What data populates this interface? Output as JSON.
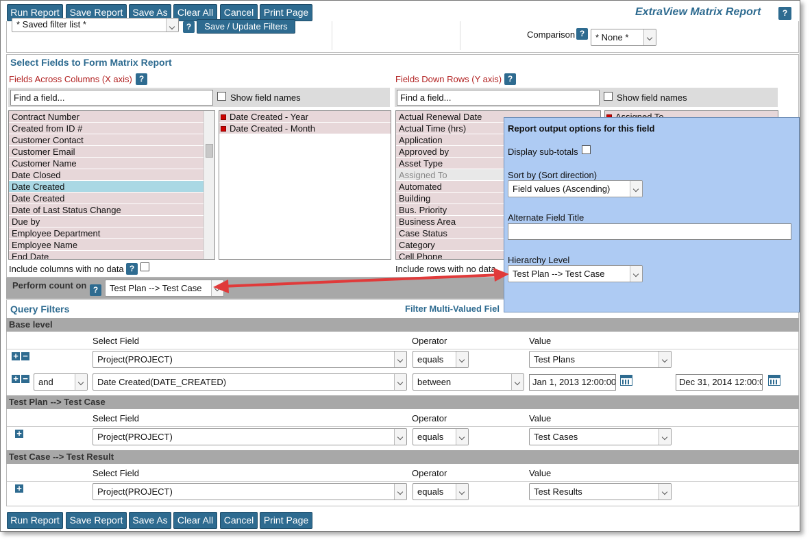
{
  "toolbar": {
    "run_report": "Run Report",
    "save_report": "Save Report",
    "save_as": "Save As",
    "clear_all": "Clear All",
    "cancel": "Cancel",
    "print_page": "Print Page"
  },
  "header": {
    "title": "ExtraView Matrix Report",
    "help": "?"
  },
  "top_partial": {
    "saved_filter_list": "* Saved filter list *",
    "save_update_filters": "Save / Update Filters",
    "comparison_label": "Comparison",
    "comparison_value": "* None *"
  },
  "matrix": {
    "section_title": "Select Fields to Form Matrix Report",
    "x_axis_label": "Fields Across Columns (X axis)",
    "y_axis_label": "Fields Down Rows (Y axis)",
    "find_placeholder": "Find a field...",
    "show_field_names": "Show field names",
    "available_x": [
      "Contract Number",
      "Created from ID #",
      "Customer Contact",
      "Customer Email",
      "Customer Name",
      "Date Closed",
      "Date Created",
      "Date Created",
      "Date of Last Status Change",
      "Due by",
      "Employee Department",
      "Employee Name",
      "End Date"
    ],
    "selected_x": [
      "Date Created - Year",
      "Date Created - Month"
    ],
    "available_y": [
      "Actual Renewal Date",
      "Actual Time (hrs)",
      "Application",
      "Approved by",
      "Asset Type",
      "Assigned To",
      "Automated",
      "Building",
      "Bus. Priority",
      "Business Area",
      "Case Status",
      "Category",
      "Cell Phone"
    ],
    "selected_y": [
      "Assigned To"
    ],
    "include_columns": "Include columns with no data",
    "include_rows": "Include rows with no data"
  },
  "perform_count": {
    "label": "Perform count on",
    "value": "Test Plan --> Test Case"
  },
  "popup": {
    "title": "Report output options for this field",
    "display_subtotals": "Display sub-totals",
    "sort_by_label": "Sort by (Sort direction)",
    "sort_by_value": "Field values (Ascending)",
    "alt_title_label": "Alternate Field Title",
    "alt_title_value": "",
    "hierarchy_label": "Hierarchy Level",
    "hierarchy_value": "Test Plan --> Test Case"
  },
  "filters": {
    "section_title": "Query Filters",
    "multi_valued": "Filter Multi-Valued Fiel",
    "col_select_field": "Select Field",
    "col_operator": "Operator",
    "col_value": "Value",
    "base_level": {
      "title": "Base level",
      "row1": {
        "field": "Project(PROJECT)",
        "operator": "equals",
        "value": "Test Plans"
      },
      "row2": {
        "connector": "and",
        "field": "Date Created(DATE_CREATED)",
        "operator": "between",
        "value_from": "Jan 1, 2013 12:00:00",
        "value_to": "Dec 31, 2014 12:00:0"
      }
    },
    "level2": {
      "title": "Test Plan --> Test Case",
      "row1": {
        "field": "Project(PROJECT)",
        "operator": "equals",
        "value": "Test Cases"
      }
    },
    "level3": {
      "title": "Test Case --> Test Result",
      "row1": {
        "field": "Project(PROJECT)",
        "operator": "equals",
        "value": "Test Results"
      }
    }
  },
  "colors": {
    "primary": "#2e6b90",
    "popup_bg": "#aecbf3",
    "list_item": "#e7d7d9",
    "list_selected": "#aad8e4",
    "arrow": "#e03a3a"
  }
}
